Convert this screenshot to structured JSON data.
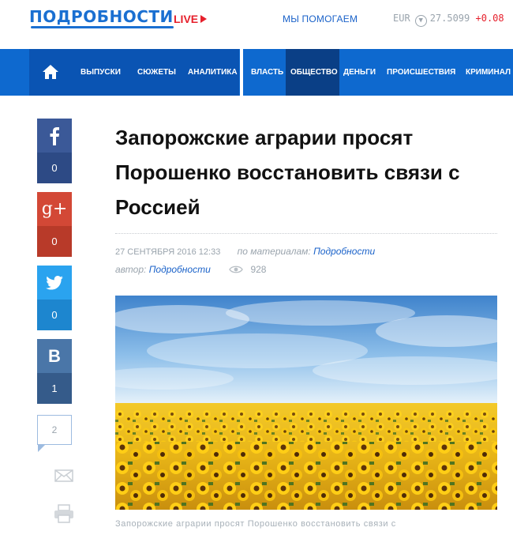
{
  "header": {
    "logo": "ПОДРОБНОСТИ",
    "live_label": "LIVE",
    "help_link": "МЫ ПОМОГАЕМ",
    "currency": {
      "code": "EUR",
      "rate": "27.5099",
      "change": "+0.08"
    }
  },
  "nav": {
    "home_icon": "home-icon",
    "left_items": [
      "ВЫПУСКИ",
      "СЮЖЕТЫ",
      "АНАЛИТИКА"
    ],
    "right_items": [
      "ВЛАСТЬ",
      "ОБЩЕСТВО",
      "ДЕНЬГИ",
      "ПРОИСШЕСТВИЯ",
      "КРИМИНАЛ"
    ],
    "active_item": "ОБЩЕСТВО"
  },
  "share": {
    "facebook": {
      "icon": "facebook-icon",
      "count": "0"
    },
    "googleplus": {
      "icon": "google-plus-icon",
      "count": "0"
    },
    "twitter": {
      "icon": "twitter-icon",
      "count": "0"
    },
    "vkontakte": {
      "icon": "vk-icon",
      "count": "1"
    },
    "comments_count": "2",
    "mail_icon": "mail-icon",
    "print_icon": "print-icon"
  },
  "article": {
    "title": "Запорожские аграрии просят Порошенко восстановить связи с Россией",
    "date": "27 сентября 2016 12:33",
    "source_label": "по материалам:",
    "source": "Подробности",
    "author_label": "автор:",
    "author": "Подробности",
    "views": "928",
    "caption": "Запорожские аграрии просят Порошенко восстановить связи с"
  },
  "colors": {
    "brand_blue": "#1a6fd1",
    "nav_blue": "#0e69cf",
    "nav_active": "#0a3f86",
    "live_red": "#e6202c"
  }
}
